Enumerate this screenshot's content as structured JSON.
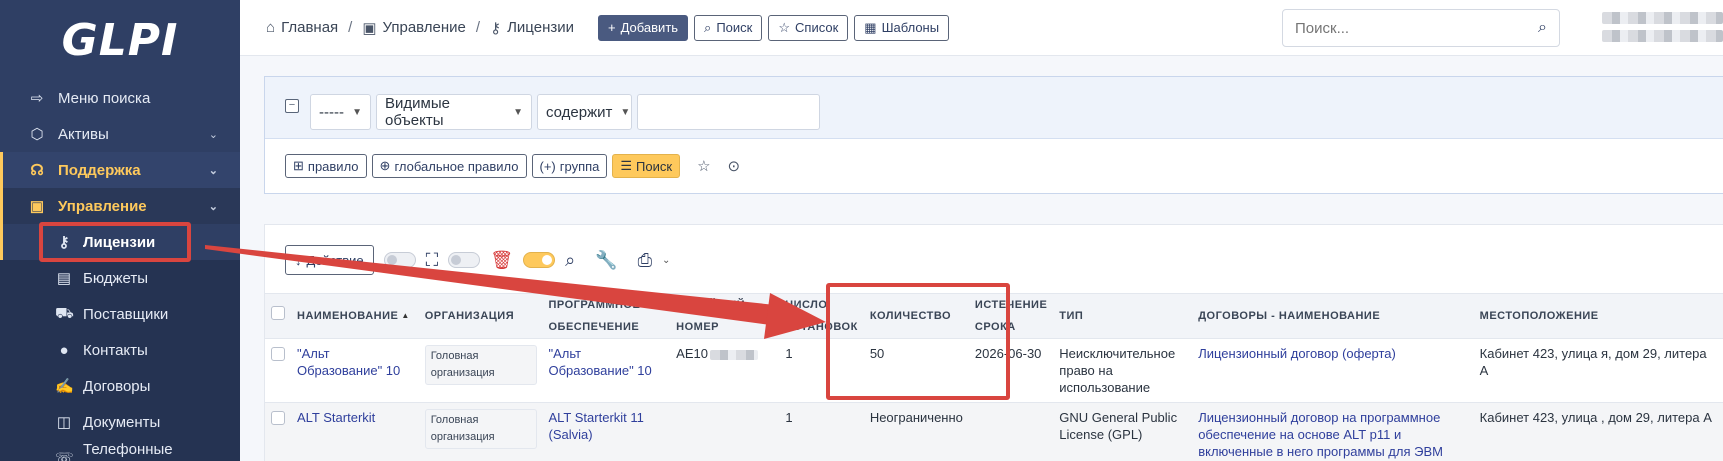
{
  "app": {
    "logo": "GLPI"
  },
  "sidebar": {
    "items": [
      {
        "label": "Меню поиска",
        "icon": "arrow-right-to-bracket-icon",
        "glyph": "⇨"
      },
      {
        "label": "Активы",
        "icon": "box-icon",
        "glyph": "⬡"
      },
      {
        "label": "Поддержка",
        "icon": "headset-icon",
        "glyph": "☊"
      },
      {
        "label": "Управление",
        "icon": "wallet-icon",
        "glyph": "▣"
      }
    ],
    "sub_items": [
      {
        "label": "Лицензии",
        "icon": "key-icon",
        "glyph": "⚷"
      },
      {
        "label": "Бюджеты",
        "icon": "calculator-icon",
        "glyph": "▤"
      },
      {
        "label": "Поставщики",
        "icon": "truck-loading-icon",
        "glyph": "⛟"
      },
      {
        "label": "Контакты",
        "icon": "user-icon",
        "glyph": "●"
      },
      {
        "label": "Договоры",
        "icon": "signature-icon",
        "glyph": "✍"
      },
      {
        "label": "Документы",
        "icon": "document-icon",
        "glyph": "◫"
      },
      {
        "label": "Телефонные линии",
        "icon": "phone-icon",
        "glyph": "☏"
      }
    ]
  },
  "header": {
    "breadcrumbs": [
      {
        "label": "Главная",
        "icon": "home-icon",
        "glyph": "⌂"
      },
      {
        "label": "Управление",
        "icon": "wallet-icon",
        "glyph": "▣"
      },
      {
        "label": "Лицензии",
        "icon": "key-icon",
        "glyph": "⚷"
      }
    ],
    "actions": {
      "add": "Добавить",
      "search": "Поиск",
      "list": "Список",
      "templates": "Шаблоны"
    },
    "search_placeholder": "Поиск..."
  },
  "criteria": {
    "field_1": "-----",
    "field_2": "Видимые объекты",
    "operator": "содержит",
    "buttons": {
      "rule": "правило",
      "global_rule": "глобальное правило",
      "group": "группа",
      "search": "Поиск"
    }
  },
  "massive": {
    "action_label": "Действие"
  },
  "table": {
    "headers": {
      "name": "НАИМЕНОВАНИЕ",
      "org": "ОРГАНИЗАЦИЯ",
      "software_1": "ПРОГРАММНОЕ",
      "software_2": "ОБЕСПЕЧЕНИЕ",
      "serial": "СЕРИЙНЫЙ НОМЕР",
      "installs_1": "ЧИСЛО",
      "installs_2": "УСТАНОВОК",
      "quantity": "КОЛИЧЕСТВО",
      "expiry_1": "ИСТЕЧЕНИЕ",
      "expiry_2": "СРОКА",
      "type": "ТИП",
      "contracts": "ДОГОВОРЫ - НАИМЕНОВАНИЕ",
      "location": "МЕСТОПОЛОЖЕНИЕ"
    },
    "rows": [
      {
        "name": "\"Альт Образование\" 10",
        "org": "Головная организация",
        "software": "\"Альт Образование\" 10",
        "serial": "AE10",
        "installs": "1",
        "quantity": "50",
        "expiry": "2026-06-30",
        "type": "Неисключительное право на использование",
        "contract": "Лицензионный договор (оферта)",
        "location": "Кабинет 423, улица я, дом 29, литера А"
      },
      {
        "name": "ALT Starterkit",
        "org": "Головная организация",
        "software": "ALT Starterkit 11 (Salvia)",
        "serial": "",
        "installs": "1",
        "quantity": "Неограниченно",
        "expiry": "",
        "type": "GNU General Public License (GPL)",
        "contract": "Лицензионный договор на программное обеспечение на основе ALT p11 и включенные в него программы для ЭВМ",
        "location": "Кабинет 423, улица , дом 29, литера А"
      }
    ]
  },
  "colors": {
    "sidebar_bg": "#2f3f64",
    "accent": "#fec95c",
    "annotation": "#d9453f",
    "link": "#2f3f9c"
  }
}
